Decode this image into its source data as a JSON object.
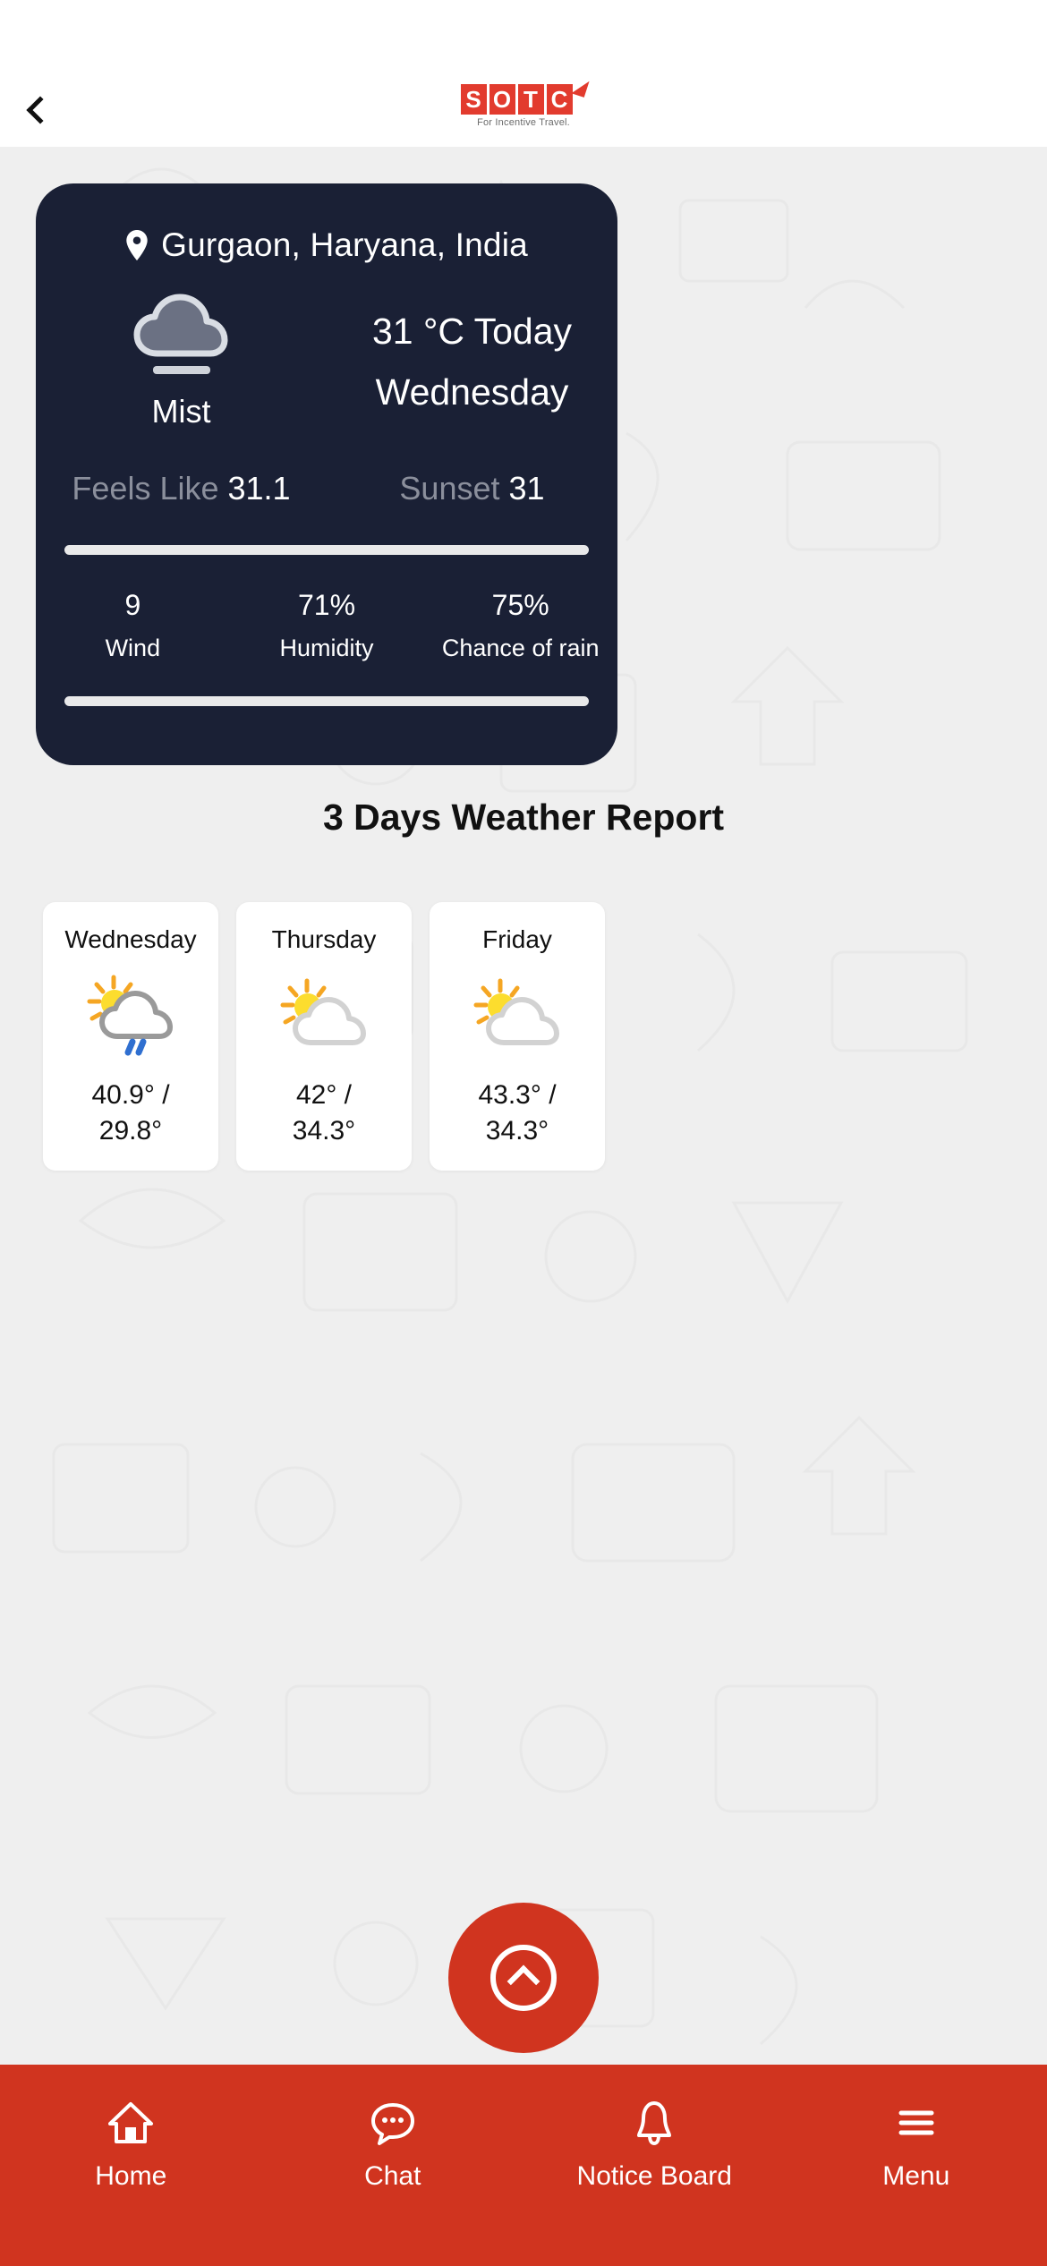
{
  "header": {
    "back_icon": "chevron-left-icon",
    "logo_letters": [
      "S",
      "O",
      "T",
      "C"
    ],
    "logo_tagline": "For Incentive Travel.",
    "brand_color": "#e23b2e"
  },
  "current": {
    "location_icon": "location-pin-icon",
    "location": "Gurgaon, Haryana, India",
    "condition_icon": "mist-cloud-icon",
    "condition": "Mist",
    "temperature_line": "31 °C Today",
    "day_line": "Wednesday",
    "feels_like_label": "Feels Like",
    "feels_like_value": "31.1",
    "sunset_label": "Sunset",
    "sunset_value": "31",
    "stats": [
      {
        "value": "9",
        "label": "Wind"
      },
      {
        "value": "71%",
        "label": "Humidity"
      },
      {
        "value": "75%",
        "label": "Chance of rain"
      }
    ],
    "card_color": "#1a2035"
  },
  "forecast": {
    "title": "3 Days Weather Report",
    "days": [
      {
        "day": "Wednesday",
        "icon": "sun-cloud-rain-icon",
        "temp": "40.9° /\n29.8°",
        "high": "40.9°",
        "low": "29.8°"
      },
      {
        "day": "Thursday",
        "icon": "sun-cloud-icon",
        "temp": "42° /\n34.3°",
        "high": "42°",
        "low": "34.3°"
      },
      {
        "day": "Friday",
        "icon": "sun-cloud-icon",
        "temp": "43.3° /\n34.3°",
        "high": "43.3°",
        "low": "34.3°"
      }
    ]
  },
  "fab": {
    "icon": "chevron-up-circle-icon"
  },
  "nav": {
    "bar_color": "#d0341f",
    "items": [
      {
        "icon": "home-icon",
        "label": "Home"
      },
      {
        "icon": "chat-bubble-icon",
        "label": "Chat"
      },
      {
        "icon": "bell-icon",
        "label": "Notice Board"
      },
      {
        "icon": "hamburger-menu-icon",
        "label": "Menu"
      }
    ]
  }
}
